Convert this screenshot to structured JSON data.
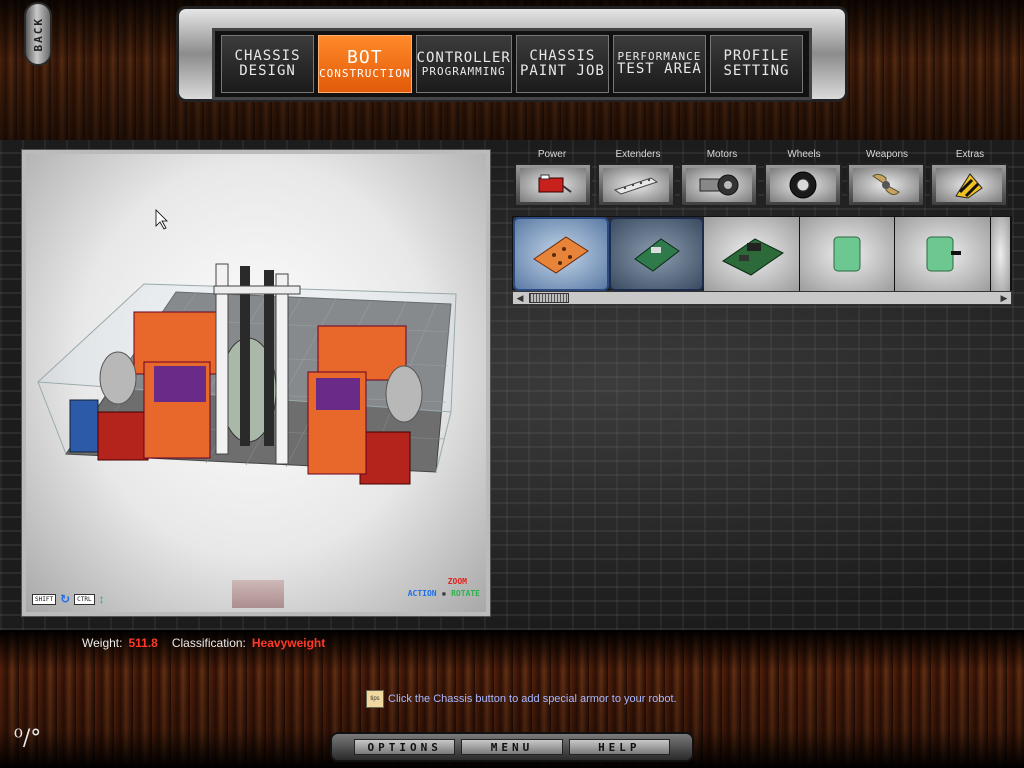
{
  "back_button": {
    "label": "BACK"
  },
  "nav_tabs": [
    {
      "line1": "CHASSIS",
      "line2": "DESIGN",
      "active": false
    },
    {
      "line1": "BOT",
      "line2": "CONSTRUCTION",
      "active": true
    },
    {
      "line1": "CONTROLLER",
      "line2": "PROGRAMMING",
      "active": false
    },
    {
      "line1": "CHASSIS",
      "line2": "PAINT JOB",
      "active": false
    },
    {
      "line1": "PERFORMANCE",
      "line2": "TEST AREA",
      "active": false
    },
    {
      "line1": "PROFILE",
      "line2": "SETTING",
      "active": false
    }
  ],
  "viewport": {
    "controls": {
      "shift_key": "SHIFT",
      "ctrl_key": "CTRL"
    },
    "legend": {
      "zoom": "ZOOM",
      "action": "ACTION",
      "rotate": "ROTATE"
    }
  },
  "categories": [
    {
      "label": "Power",
      "icon": "battery-icon"
    },
    {
      "label": "Extenders",
      "icon": "extender-bar-icon"
    },
    {
      "label": "Motors",
      "icon": "motor-icon"
    },
    {
      "label": "Wheels",
      "icon": "wheel-icon"
    },
    {
      "label": "Weapons",
      "icon": "blade-icon"
    },
    {
      "label": "Extras",
      "icon": "hazard-icon"
    }
  ],
  "parts": [
    {
      "icon": "orange-board-icon",
      "state": "selected"
    },
    {
      "icon": "green-board-icon",
      "state": "hover"
    },
    {
      "icon": "circuit-board-icon",
      "state": "normal"
    },
    {
      "icon": "green-block-icon",
      "state": "normal"
    },
    {
      "icon": "green-block-plug-icon",
      "state": "normal"
    }
  ],
  "status": {
    "weight_label": "Weight:",
    "weight_value": "511.8",
    "class_label": "Classification:",
    "class_value": "Heavyweight"
  },
  "tip": {
    "icon_label": "tips",
    "text": "Click the Chassis button to add special armor to your robot."
  },
  "bottom_menu": {
    "options": "OPTIONS",
    "menu": "MENU",
    "help": "HELP"
  },
  "colors": {
    "active_tab": "#e25a08",
    "value_red": "#ff3a2a",
    "tip_text": "#a8b8ff"
  }
}
